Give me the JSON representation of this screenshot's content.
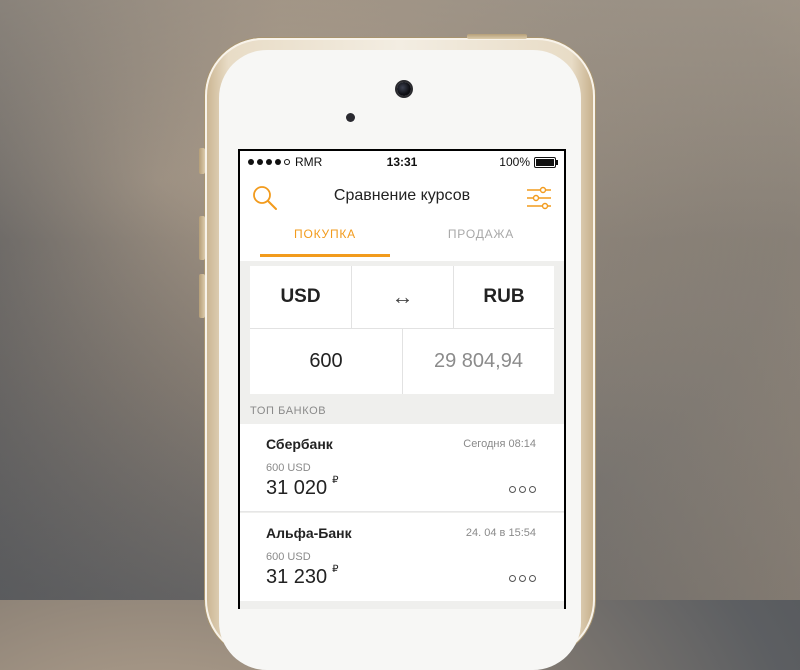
{
  "status_bar": {
    "carrier": "RMR",
    "time": "13:31",
    "battery": "100%"
  },
  "nav": {
    "title": "Сравнение курсов",
    "left_icon": "search-icon",
    "right_icon": "filter-settings-icon"
  },
  "tabs": [
    {
      "label": "ПОКУПКА",
      "active": true
    },
    {
      "label": "ПРОДАЖА",
      "active": false
    }
  ],
  "converter": {
    "from_currency": "USD",
    "swap_symbol": "↔",
    "to_currency": "RUB",
    "from_amount": "600",
    "to_amount": "29 804,94"
  },
  "section": {
    "title": "ТОП БАНКОВ"
  },
  "banks": [
    {
      "name": "Сбербанк",
      "date": "Сегодня 08:14",
      "subtitle": "600 USD",
      "amount": "31 020",
      "currency_sign": "₽"
    },
    {
      "name": "Альфа-Банк",
      "date": "24. 04 в 15:54",
      "subtitle": "600 USD",
      "amount": "31 230",
      "currency_sign": "₽"
    }
  ],
  "colors": {
    "accent": "#f29b1d",
    "text": "#222222",
    "muted": "#8a8a8a",
    "background": "#efefed"
  }
}
